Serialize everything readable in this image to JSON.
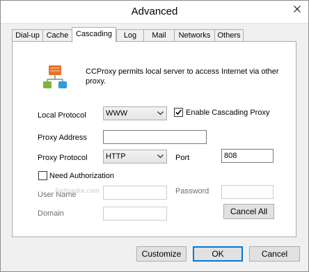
{
  "window": {
    "title": "Advanced"
  },
  "tabs": [
    {
      "label": "Dial-up"
    },
    {
      "label": "Cache"
    },
    {
      "label": "Cascading"
    },
    {
      "label": "Log"
    },
    {
      "label": "Mail"
    },
    {
      "label": "Networks"
    },
    {
      "label": "Others"
    }
  ],
  "active_tab": "Cascading",
  "cascading": {
    "description": "CCProxy permits local server to access Internet via other proxy.",
    "local_protocol_label": "Local Protocol",
    "local_protocol_value": "WWW",
    "enable_cascading_label": "Enable Cascading Proxy",
    "enable_cascading_checked": true,
    "proxy_address_label": "Proxy Address",
    "proxy_address_value": "",
    "proxy_protocol_label": "Proxy Protocol",
    "proxy_protocol_value": "HTTP",
    "port_label": "Port",
    "port_value": "808",
    "need_auth_label": "Need Authorization",
    "need_auth_checked": false,
    "user_name_label": "User Name",
    "user_name_value": "",
    "password_label": "Password",
    "password_value": "",
    "domain_label": "Domain",
    "domain_value": "",
    "cancel_all_label": "Cancel All"
  },
  "footer": {
    "customize_label": "Customize",
    "ok_label": "OK",
    "cancel_label": "Cancel"
  },
  "watermark": "Softpedia.com",
  "icons": {
    "close": "close-icon",
    "network": "network-proxy-icon",
    "dropdown": "chevron-down-icon",
    "check": "checkmark-icon"
  },
  "colors": {
    "accent": "#0078d7",
    "icon_orange": "#e8702a",
    "icon_green": "#7db53a",
    "icon_blue": "#2f9bd8"
  }
}
